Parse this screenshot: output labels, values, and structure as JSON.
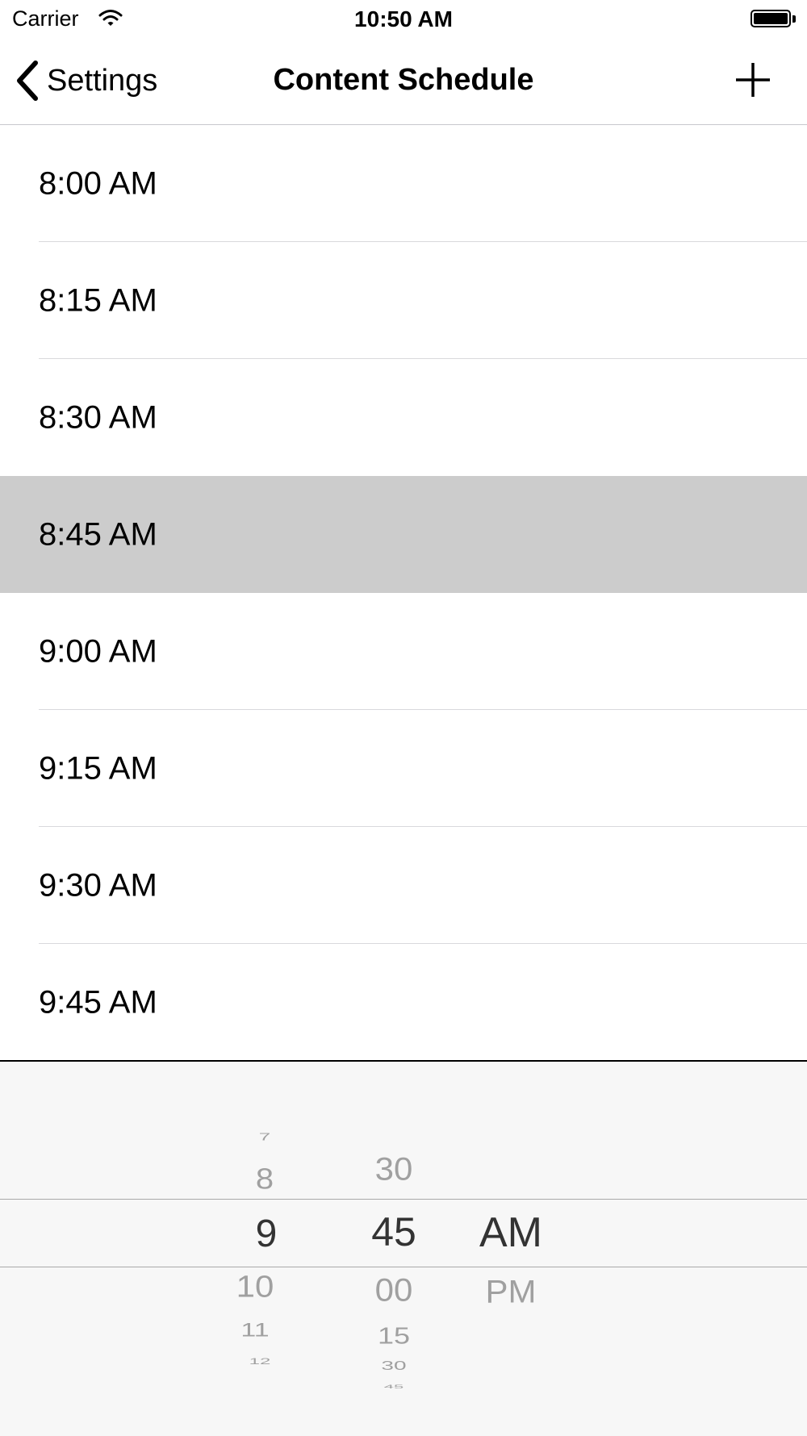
{
  "status_bar": {
    "carrier": "Carrier",
    "time": "10:50 AM"
  },
  "nav": {
    "back_label": "Settings",
    "title": "Content Schedule"
  },
  "schedule": {
    "times": [
      "8:00 AM",
      "8:15 AM",
      "8:30 AM",
      "8:45 AM",
      "9:00 AM",
      "9:15 AM",
      "9:30 AM",
      "9:45 AM"
    ],
    "selected_index": 3
  },
  "picker": {
    "hours": [
      "7",
      "8",
      "9",
      "10",
      "11",
      "12"
    ],
    "minutes": [
      "30",
      "45",
      "00",
      "15",
      "30",
      "45"
    ],
    "periods": [
      "AM",
      "PM"
    ],
    "selected": {
      "hour": "9",
      "minute": "45",
      "period": "AM"
    }
  },
  "colors": {
    "selected_row": "#cccccc",
    "picker_background": "#f7f7f7"
  },
  "icons": {
    "back": "chevron-left-icon",
    "add": "plus-icon",
    "wifi": "wifi-icon",
    "battery": "battery-icon"
  }
}
